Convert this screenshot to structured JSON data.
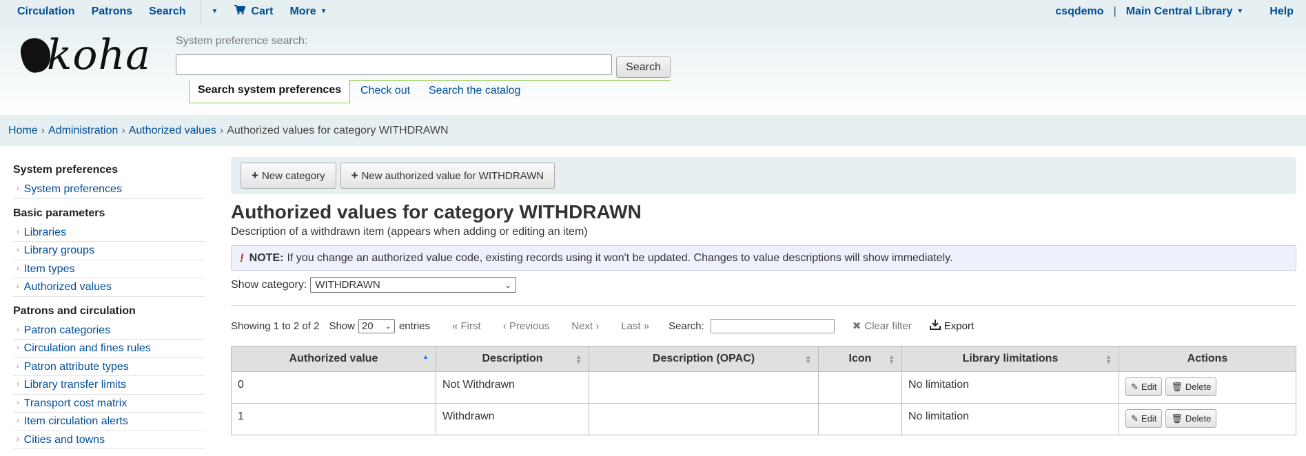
{
  "topnav": {
    "circulation": "Circulation",
    "patrons": "Patrons",
    "search": "Search",
    "cart": "Cart",
    "more": "More",
    "user": "csqdemo",
    "library": "Main Central Library",
    "help": "Help"
  },
  "header": {
    "logo": "koha",
    "syspref_label": "System preference search:",
    "syspref_value": "",
    "search_button": "Search",
    "tabs": [
      "Search system preferences",
      "Check out",
      "Search the catalog"
    ]
  },
  "breadcrumb": [
    "Home",
    "Administration",
    "Authorized values",
    "Authorized values for category WITHDRAWN"
  ],
  "sidebar": {
    "sections": [
      {
        "title": "System preferences",
        "items": [
          "System preferences"
        ]
      },
      {
        "title": "Basic parameters",
        "items": [
          "Libraries",
          "Library groups",
          "Item types",
          "Authorized values"
        ]
      },
      {
        "title": "Patrons and circulation",
        "items": [
          "Patron categories",
          "Circulation and fines rules",
          "Patron attribute types",
          "Library transfer limits",
          "Transport cost matrix",
          "Item circulation alerts",
          "Cities and towns"
        ]
      }
    ]
  },
  "toolbar": {
    "new_category": "New category",
    "new_value": "New authorized value for WITHDRAWN"
  },
  "page": {
    "title": "Authorized values for category WITHDRAWN",
    "description": "Description of a withdrawn item (appears when adding or editing an item)",
    "note_label": "NOTE:",
    "note_text": "If you change an authorized value code, existing records using it won't be updated. Changes to value descriptions will show immediately.",
    "show_category_label": "Show category:",
    "show_category_value": "WITHDRAWN"
  },
  "pager": {
    "info": "Showing 1 to 2 of 2",
    "show": "Show",
    "length": "20",
    "entries": "entries",
    "first": "First",
    "previous": "Previous",
    "next": "Next",
    "last": "Last",
    "search_label": "Search:",
    "clear": "Clear filter",
    "export": "Export"
  },
  "table": {
    "headers": [
      "Authorized value",
      "Description",
      "Description (OPAC)",
      "Icon",
      "Library limitations",
      "Actions"
    ],
    "rows": [
      {
        "value": "0",
        "description": "Not Withdrawn",
        "opac": "",
        "icon": "",
        "limitations": "No limitation"
      },
      {
        "value": "1",
        "description": "Withdrawn",
        "opac": "",
        "icon": "",
        "limitations": "No limitation"
      }
    ],
    "edit_label": "Edit",
    "delete_label": "Delete"
  },
  "icons": {
    "cart": "cart-icon",
    "caret": "caret-down-icon",
    "plus": "plus-icon",
    "note": "exclamation-icon",
    "clear": "close-icon",
    "export": "download-icon",
    "edit": "pencil-icon",
    "delete": "trash-icon"
  }
}
